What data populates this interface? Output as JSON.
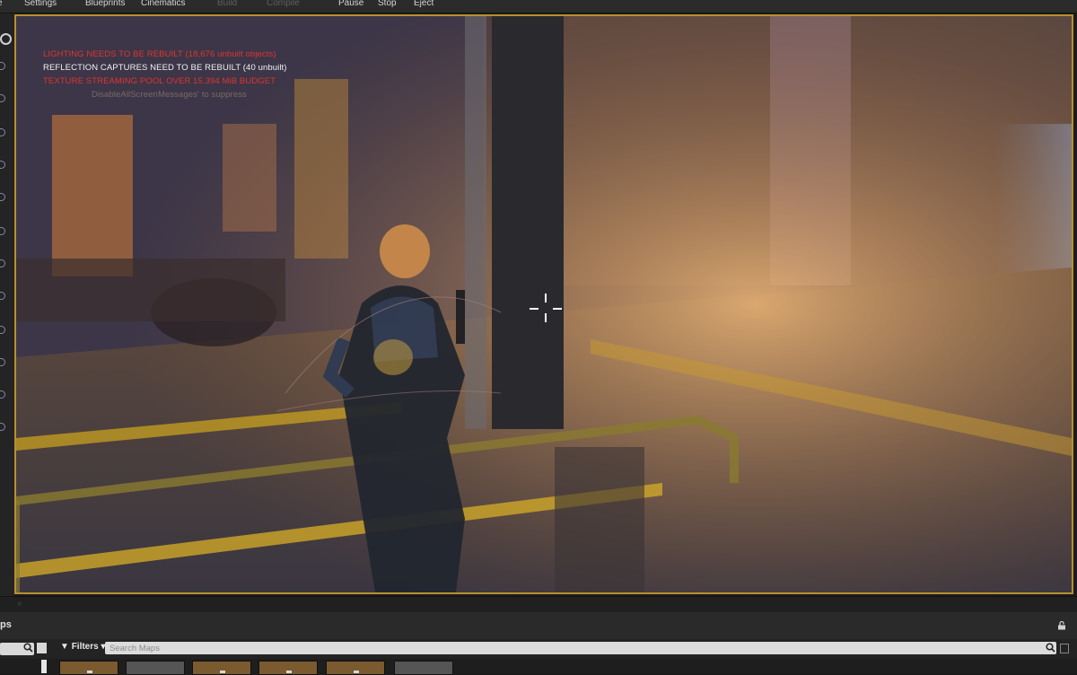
{
  "toolbar": {
    "items": [
      {
        "label": "e",
        "enabled": true
      },
      {
        "label": "Settings",
        "enabled": true
      },
      {
        "label": "Blueprints",
        "enabled": true
      },
      {
        "label": "Cinematics",
        "enabled": true
      },
      {
        "label": "Build",
        "enabled": false
      },
      {
        "label": "Compile",
        "enabled": false
      },
      {
        "label": "Pause",
        "enabled": true
      },
      {
        "label": "Stop",
        "enabled": true
      },
      {
        "label": "Eject",
        "enabled": true
      }
    ]
  },
  "viewport": {
    "messages": [
      {
        "text": "LIGHTING NEEDS TO BE REBUILT (18,676 unbuilt objects)",
        "color": "#e0342e"
      },
      {
        "text": "REFLECTION CAPTURES NEED TO BE REBUILT (40 unbuilt)",
        "color": "#f0f0f0"
      },
      {
        "text": "TEXTURE STREAMING POOL OVER 15.394 MiB BUDGET",
        "color": "#e0342e"
      }
    ],
    "faint_message": "DisableAllScreenMessages' to suppress",
    "crosshair_icon": "crosshair-icon",
    "accent_border": "#b8902e"
  },
  "bottom_panel": {
    "title": "ps",
    "tab_close": "×",
    "filters_label": "Filters",
    "search_placeholder": "Search Maps",
    "icons": [
      "lock-icon",
      "search-icon",
      "list-view-icon",
      "filter-icon",
      "save-icon"
    ],
    "thumbnail_colors": [
      "#7a5a2e",
      "#555555",
      "#7a5a2e",
      "#7a5a2e",
      "#7a5a2e",
      "#555555"
    ]
  }
}
